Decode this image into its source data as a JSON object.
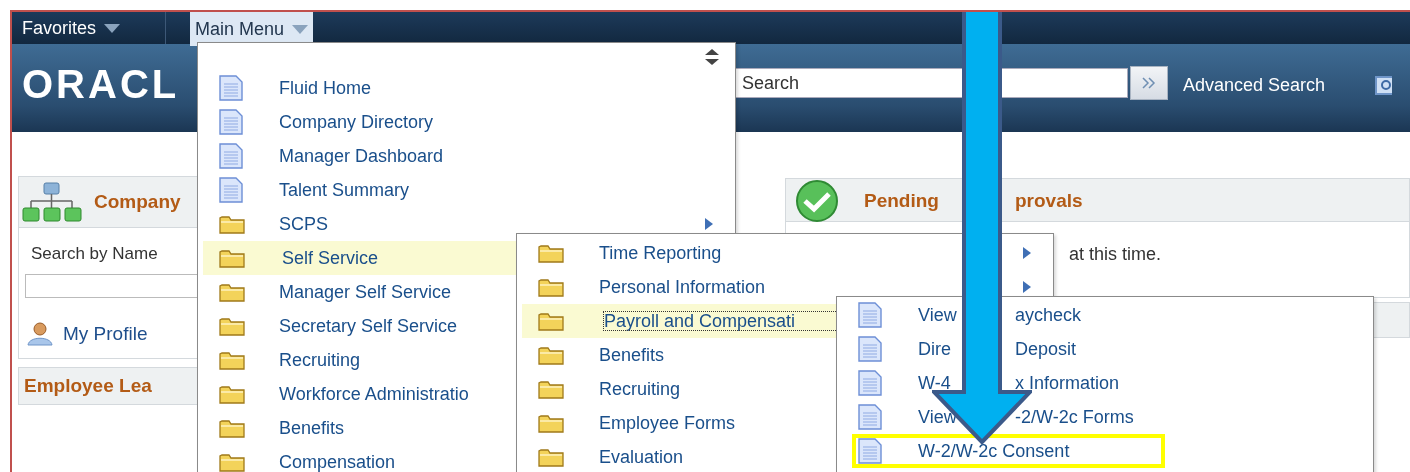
{
  "nav": [
    {
      "label": "Favorites",
      "selected": false
    },
    {
      "label": "Main Menu",
      "selected": true
    }
  ],
  "header": {
    "logo": "ORACL",
    "search": {
      "placeholder": "Search"
    },
    "advanced_search": "Advanced Search"
  },
  "company_panel": {
    "title": "Company",
    "search_label": "Search by Name",
    "profile_link": "My Profile"
  },
  "leave_panel": {
    "title": "Employee Lea"
  },
  "approvals_panel": {
    "title": "Pending",
    "title_after": "provals",
    "message": "at this time."
  },
  "menus": [
    {
      "items": [
        {
          "label": "Fluid Home",
          "kind": "page",
          "submenu": false,
          "selected": false
        },
        {
          "label": "Company Directory",
          "kind": "page",
          "submenu": false,
          "selected": false
        },
        {
          "label": "Manager Dashboard",
          "kind": "page",
          "submenu": false,
          "selected": false
        },
        {
          "label": "Talent Summary",
          "kind": "page",
          "submenu": false,
          "selected": false
        },
        {
          "label": "SCPS",
          "kind": "folder",
          "submenu": true,
          "selected": false
        },
        {
          "label": "Self Service",
          "kind": "folder",
          "submenu": false,
          "selected": true
        },
        {
          "label": "Manager Self Service",
          "kind": "folder",
          "submenu": false,
          "selected": false
        },
        {
          "label": "Secretary Self Service",
          "kind": "folder",
          "submenu": false,
          "selected": false
        },
        {
          "label": "Recruiting",
          "kind": "folder",
          "submenu": false,
          "selected": false
        },
        {
          "label": "Workforce Administratio",
          "kind": "folder",
          "submenu": false,
          "selected": false
        },
        {
          "label": "Benefits",
          "kind": "folder",
          "submenu": false,
          "selected": false
        },
        {
          "label": "Compensation",
          "kind": "folder",
          "submenu": false,
          "selected": false
        }
      ]
    },
    {
      "items": [
        {
          "label": "Time Reporting",
          "kind": "folder",
          "submenu": true,
          "selected": false
        },
        {
          "label": "Personal Information",
          "kind": "folder",
          "submenu": true,
          "selected": false
        },
        {
          "label": "Payroll and Compensati",
          "kind": "folder",
          "submenu": false,
          "selected": true
        },
        {
          "label": "Benefits",
          "kind": "folder",
          "submenu": false,
          "selected": false
        },
        {
          "label": "Recruiting",
          "kind": "folder",
          "submenu": false,
          "selected": false
        },
        {
          "label": "Employee Forms",
          "kind": "folder",
          "submenu": false,
          "selected": false
        },
        {
          "label": "Evaluation",
          "kind": "folder",
          "submenu": false,
          "selected": false
        }
      ]
    },
    {
      "items": [
        {
          "label": "View",
          "label_after": "aycheck",
          "kind": "page",
          "submenu": false,
          "selected": false,
          "annotated": false
        },
        {
          "label": "Dire",
          "label_after": "Deposit",
          "kind": "page",
          "submenu": false,
          "selected": false,
          "annotated": false
        },
        {
          "label": "W-4",
          "label_after": "x Information",
          "kind": "page",
          "submenu": false,
          "selected": false,
          "annotated": false
        },
        {
          "label": "View",
          "label_after": "-2/W-2c Forms",
          "kind": "page",
          "submenu": false,
          "selected": false,
          "annotated": false
        },
        {
          "label": "W-2/W-2c Consent",
          "kind": "page",
          "submenu": false,
          "selected": false,
          "annotated": true
        }
      ]
    }
  ]
}
